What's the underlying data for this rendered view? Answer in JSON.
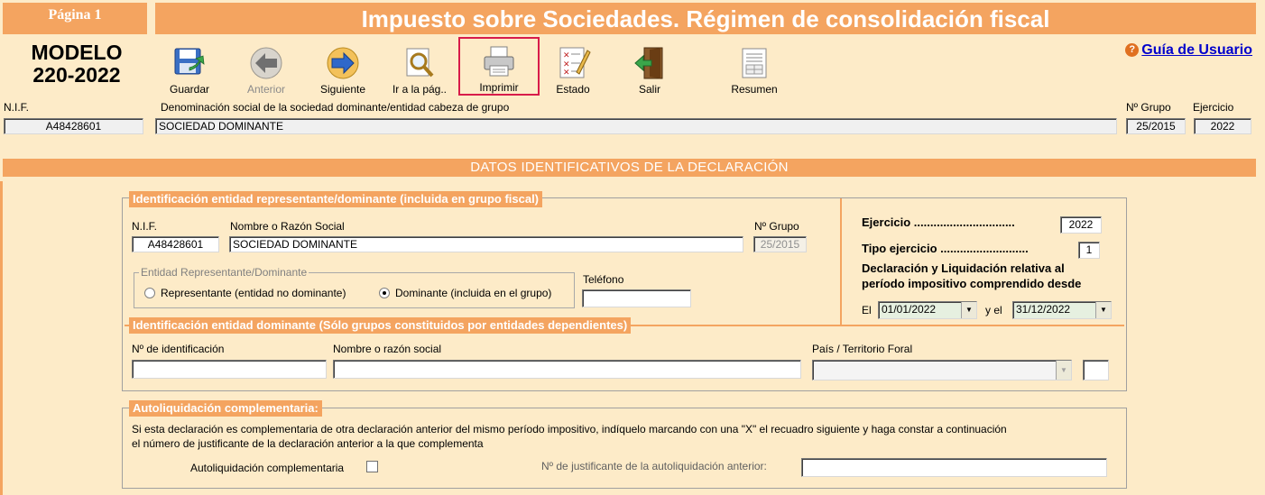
{
  "header": {
    "page_label": "Página 1",
    "title": "Impuesto sobre Sociedades. Régimen de consolidación fiscal",
    "model_line1": "MODELO",
    "model_line2": "220-2022",
    "help_link": "Guía de Usuario",
    "help_icon": "question-icon"
  },
  "toolbar": [
    {
      "label": "Guardar",
      "icon": "save-icon",
      "disabled": false,
      "selected": false
    },
    {
      "label": "Anterior",
      "icon": "arrow-left-icon",
      "disabled": true,
      "selected": false
    },
    {
      "label": "Siguiente",
      "icon": "arrow-right-icon",
      "disabled": false,
      "selected": false
    },
    {
      "label": "Ir a la pág..",
      "icon": "magnifier-icon",
      "disabled": false,
      "selected": false
    },
    {
      "label": "Imprimir",
      "icon": "printer-icon",
      "disabled": false,
      "selected": true
    },
    {
      "label": "Estado",
      "icon": "checklist-icon",
      "disabled": false,
      "selected": false
    },
    {
      "label": "Salir",
      "icon": "exit-door-icon",
      "disabled": false,
      "selected": false
    },
    {
      "label": "Resumen",
      "icon": "summary-icon",
      "disabled": false,
      "selected": false
    }
  ],
  "top_fields": {
    "nif_label": "N.I.F.",
    "nif_value": "A48428601",
    "denominacion_label": "Denominación social de la sociedad dominante/entidad cabeza de grupo",
    "denominacion_value": "SOCIEDAD DOMINANTE",
    "grupo_label": "Nº Grupo",
    "grupo_value": "25/2015",
    "ejercicio_label": "Ejercicio",
    "ejercicio_value": "2022"
  },
  "section_title": "DATOS IDENTIFICATIVOS DE LA DECLARACIÓN",
  "representante": {
    "title": "Identificación entidad representante/dominante (incluida en grupo fiscal)",
    "nif_label": "N.I.F.",
    "nif_value": "A48428601",
    "nombre_label": "Nombre o Razón Social",
    "nombre_value": "SOCIEDAD DOMINANTE",
    "grupo_label": "Nº Grupo",
    "grupo_value": "25/2015",
    "radio_group_label": "Entidad Representante/Dominante",
    "radio_representante": "Representante (entidad no dominante)",
    "radio_dominante": "Dominante (incluida en el grupo)",
    "selected_option": "Dominante (incluida en el grupo)",
    "telefono_label": "Teléfono",
    "telefono_value": ""
  },
  "ejercicio_panel": {
    "ejercicio_label": "Ejercicio ...............................",
    "ejercicio_value": "2022",
    "tipo_label": "Tipo ejercicio ...........................",
    "tipo_value": "1",
    "periodo_line1": "Declaración y Liquidación relativa al",
    "periodo_line2": "período impositivo comprendido desde",
    "el_label": "El",
    "fecha_desde": "01/01/2022",
    "y_el_label": "y el",
    "fecha_hasta": "31/12/2022"
  },
  "dominante": {
    "title": "Identificación entidad dominante (Sólo grupos constituidos por entidades dependientes)",
    "id_label": "Nº de identificación",
    "id_value": "",
    "nombre_label": "Nombre o razón social",
    "nombre_value": "",
    "pais_label": "País / Territorio Foral",
    "pais_value": "",
    "pais_code": ""
  },
  "complementaria": {
    "title": "Autoliquidación complementaria:",
    "text_line1": "Si esta declaración es complementaria de otra declaración anterior del mismo período impositivo, indíquelo marcando con una \"X\" el recuadro siguiente y haga constar a continuación",
    "text_line2": "el número de justificante de la declaración anterior a la que complementa",
    "checkbox_label": "Autoliquidación complementaria",
    "checked": false,
    "justificante_label": "Nº de justificante de la autoliquidación anterior:",
    "justificante_value": ""
  },
  "colors": {
    "accent": "#f4a460",
    "background": "#fdebc8",
    "selected_border": "#d81b4a",
    "link": "#0000cc"
  }
}
